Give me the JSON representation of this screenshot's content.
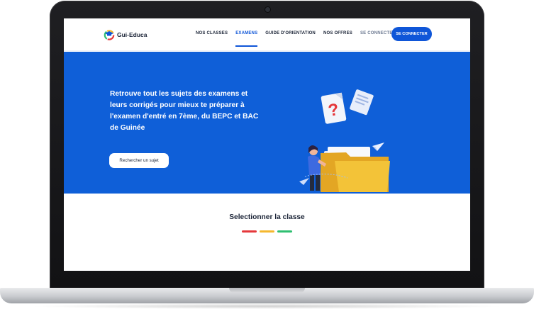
{
  "brand": {
    "name": "Gui-Educa",
    "logo_icon": "graduation-cap-logo-icon"
  },
  "nav": {
    "items": [
      {
        "label": "NOS CLASSES"
      },
      {
        "label": "EXAMENS"
      },
      {
        "label": "GUIDE D'ORIENTATION"
      },
      {
        "label": "NOS OFFRES"
      },
      {
        "label": "SE CONNECTER"
      }
    ],
    "active_item": "EXAMENS",
    "cta_label": "SE CONNECTER"
  },
  "hero": {
    "headline": "Retrouve tout les sujets des examens et leurs corrigés pour mieux te préparer à l'examen d'entré en 7ème, du BEPC et BAC de Guinée",
    "button_label": "Rechercher un sujet",
    "illustration": "folder-with-documents-and-question-mark-illustration"
  },
  "classes": {
    "title": "Selectionner la classe",
    "accent_colors": [
      "#e5383b",
      "#f5b82e",
      "#2fbf71"
    ]
  },
  "colors": {
    "primary": "#0f56d8",
    "hero_background": "#0f5fd8",
    "text_dark": "#1b2437"
  }
}
